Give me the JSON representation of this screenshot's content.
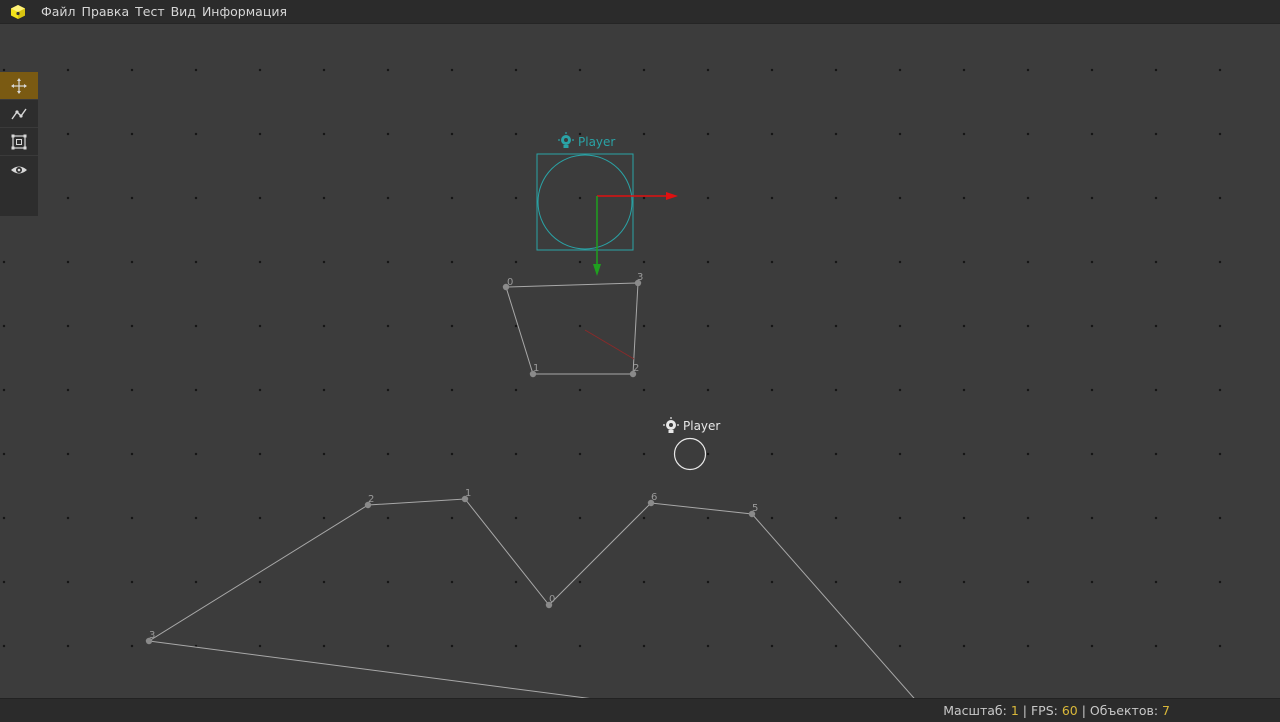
{
  "menu": {
    "items": [
      {
        "label": "Файл"
      },
      {
        "label": "Правка"
      },
      {
        "label": "Тест"
      },
      {
        "label": "Вид"
      },
      {
        "label": "Информация"
      }
    ]
  },
  "toolbar": {
    "tools": [
      {
        "icon": "move-icon",
        "active": true
      },
      {
        "icon": "polyline-icon",
        "active": false
      },
      {
        "icon": "transform-box-icon",
        "active": false
      },
      {
        "icon": "eye-icon",
        "active": false
      }
    ]
  },
  "objects": [
    {
      "label": "Player",
      "selected": true
    },
    {
      "label": "Player",
      "selected": false
    }
  ],
  "polygon_upper": {
    "vertex_labels": [
      "0",
      "3",
      "1",
      "2"
    ]
  },
  "polyline_lower": {
    "vertex_labels": [
      "3",
      "2",
      "1",
      "0",
      "6",
      "5"
    ]
  },
  "status": {
    "scale_label": "Масштаб:",
    "scale_value": "1",
    "fps_label": "FPS:",
    "fps_value": "60",
    "objects_label": "Объектов:",
    "objects_value": "7",
    "separator": "|"
  },
  "colors": {
    "background": "#3c3c3c",
    "selected_object": "#2aa3a6",
    "axis_x": "#e01010",
    "axis_y": "#1fa01f",
    "accent_active_tool": "#7a5a12",
    "status_value": "#d9b83a",
    "app_icon": "#f2e21a"
  }
}
